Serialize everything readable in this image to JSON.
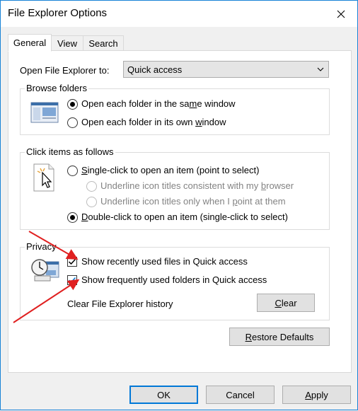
{
  "window": {
    "title": "File Explorer Options"
  },
  "tabs": [
    {
      "label": "General",
      "active": true
    },
    {
      "label": "View",
      "active": false
    },
    {
      "label": "Search",
      "active": false
    }
  ],
  "open_in": {
    "label": "Open File Explorer to:",
    "value": "Quick access"
  },
  "browse": {
    "title": "Browse folders",
    "opt1_a": "Open each folder in the sa",
    "opt1_u": "m",
    "opt1_b": "e window",
    "opt2_a": "Open each folder in its own ",
    "opt2_u": "w",
    "opt2_b": "indow",
    "selected": 0
  },
  "click": {
    "title": "Click items as follows",
    "single_u": "S",
    "single_b": "ingle-click to open an item (point to select)",
    "ul1_a": "Underline icon titles consistent with my ",
    "ul1_u": "b",
    "ul1_b": "rowser",
    "ul2_a": "Underline icon titles only when I ",
    "ul2_u": "p",
    "ul2_b": "oint at them",
    "double_u": "D",
    "double_b": "ouble-click to open an item (single-click to select)",
    "selected": "double"
  },
  "privacy": {
    "title": "Privacy",
    "recent": {
      "label": "Show recently used files in Quick access",
      "checked": true
    },
    "frequent": {
      "label": "Show frequently used folders in Quick access",
      "checked": true
    },
    "clear_label": "Clear File Explorer history",
    "clear_u": "C",
    "clear_b": "lear"
  },
  "restore": {
    "u": "R",
    "b": "estore Defaults"
  },
  "footer": {
    "ok": "OK",
    "cancel": "Cancel",
    "apply_u": "A",
    "apply_b": "pply"
  },
  "colors": {
    "accent": "#0078d7",
    "annotation_arrow": "#e02020"
  }
}
